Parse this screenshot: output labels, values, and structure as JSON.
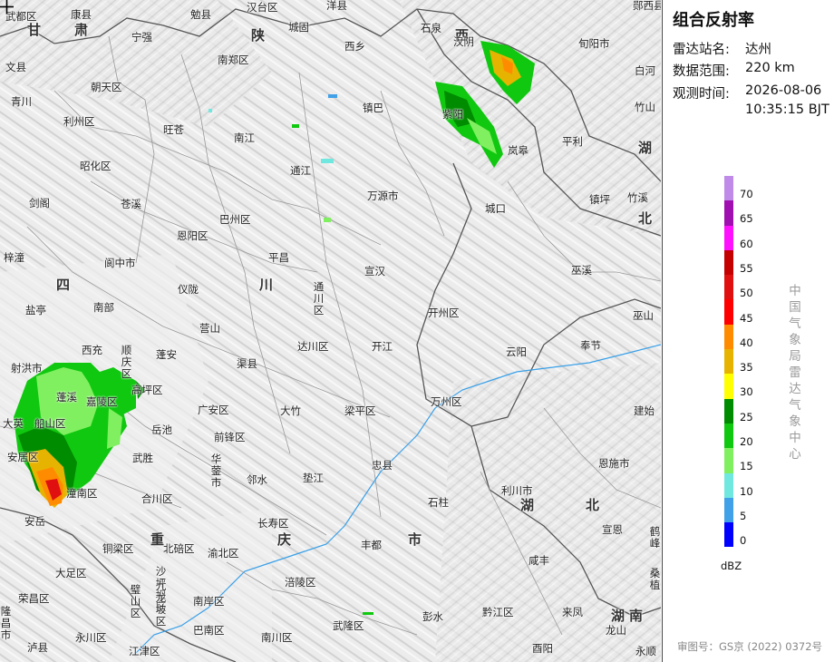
{
  "legend": {
    "title": "组合反射率",
    "station_label": "雷达站名:",
    "station": "达州",
    "range_label": "数据范围:",
    "range": "220 km",
    "time_label": "观测时间:",
    "date": "2026-08-06",
    "time": "10:35:15 BJT",
    "unit": "dBZ",
    "org": "中国气象局雷达气象中心",
    "approval": "审图号：GS京 (2022) 0372号",
    "colors": [
      "#c08ae8",
      "#a010b0",
      "#ff10ff",
      "#c40000",
      "#e01010",
      "#ff0000",
      "#ff8c00",
      "#e6b400",
      "#ffff00",
      "#008c00",
      "#10c810",
      "#80f060",
      "#70e8e0",
      "#40a0e8",
      "#0000ff"
    ],
    "ticks": [
      "70",
      "65",
      "60",
      "55",
      "50",
      "45",
      "40",
      "35",
      "30",
      "25",
      "20",
      "15",
      "10",
      "5",
      "0"
    ]
  },
  "provinces": [
    "甘",
    "肃",
    "陕",
    "西",
    "湖",
    "北",
    "四",
    "川",
    "重",
    "庆",
    "市",
    "湖",
    "北",
    "湖",
    "南"
  ],
  "places": [
    "武都区",
    "康县",
    "勉县",
    "汉台区",
    "洋县",
    "汉阴",
    "郧西县",
    "文县",
    "宁强",
    "南郑区",
    "城固",
    "西乡",
    "石泉",
    "旬阳市",
    "白河",
    "青川",
    "朝天区",
    "紫阳",
    "岚皋",
    "竹山",
    "利州区",
    "旺苍",
    "南江",
    "镇巴",
    "平利",
    "昭化区",
    "通江",
    "万源市",
    "镇坪",
    "竹溪",
    "剑阁",
    "苍溪",
    "巴州区",
    "城口",
    "梓潼",
    "恩阳区",
    "阆中市",
    "平昌",
    "宣汉",
    "巫溪",
    "盐亭",
    "南部",
    "仪陇",
    "通川区",
    "开州区",
    "巫山",
    "营山",
    "达川区",
    "开江",
    "云阳",
    "奉节",
    "西充",
    "顺庆区",
    "蓬安",
    "渠县",
    "射洪市",
    "嘉陵区",
    "高坪区",
    "广安区",
    "大竹",
    "梁平区",
    "万州区",
    "建始",
    "蓬溪",
    "大英",
    "船山区",
    "岳池",
    "前锋区",
    "华蓥市",
    "恩施市",
    "安居区",
    "武胜",
    "邻水",
    "垫江",
    "忠县",
    "石柱",
    "利川市",
    "潼南区",
    "合川区",
    "长寿区",
    "宣恩",
    "安岳",
    "丰都",
    "铜梁区",
    "北碚区",
    "渝北区",
    "咸丰",
    "大足区",
    "沙坪坝区",
    "涪陵区",
    "荣昌区",
    "九龙坡区",
    "南岸区",
    "璧山区",
    "彭水",
    "黔江区",
    "来凤",
    "龙山",
    "隆昌市",
    "永川区",
    "巴南区",
    "南川区",
    "武隆区",
    "泸县",
    "江津区",
    "酉阳",
    "永顺",
    "鹤峰",
    "桑植"
  ]
}
